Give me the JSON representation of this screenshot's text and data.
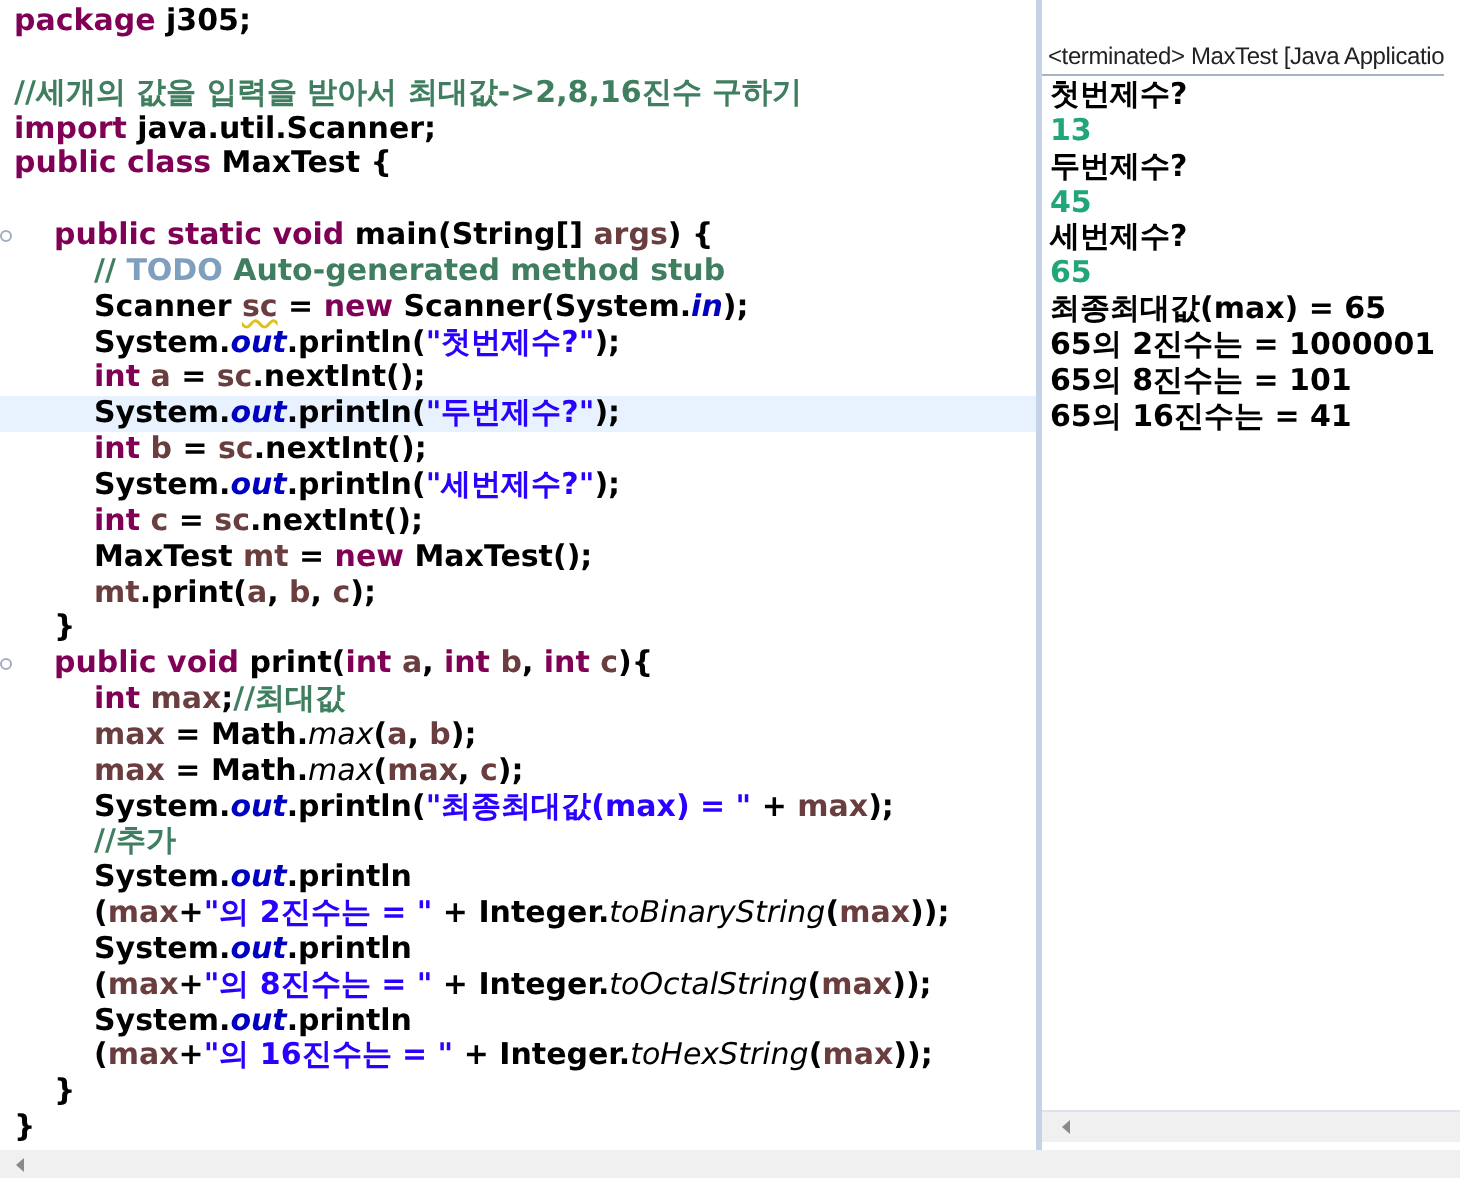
{
  "editor": {
    "lines": [
      {
        "kind": "code",
        "highlighted": false,
        "foldable": false,
        "tokens": [
          {
            "text": "package",
            "kind": "keyword"
          },
          {
            "text": " j305;",
            "kind": "plain"
          }
        ]
      },
      {
        "kind": "blank",
        "highlighted": false,
        "foldable": false
      },
      {
        "kind": "code",
        "highlighted": false,
        "foldable": false,
        "tokens": [
          {
            "text": "//세개의 값을 입력을 받아서 최대값->2,8,16진수 구하기",
            "kind": "comment"
          }
        ]
      },
      {
        "kind": "code",
        "highlighted": false,
        "foldable": false,
        "tokens": [
          {
            "text": "import",
            "kind": "keyword"
          },
          {
            "text": " java.util.Scanner;",
            "kind": "plain"
          }
        ]
      },
      {
        "kind": "code",
        "highlighted": false,
        "foldable": false,
        "tokens": [
          {
            "text": "public class",
            "kind": "keyword"
          },
          {
            "text": " MaxTest {",
            "kind": "plain"
          }
        ]
      },
      {
        "kind": "blank",
        "highlighted": false,
        "foldable": false
      },
      {
        "kind": "code",
        "highlighted": false,
        "foldable": true,
        "tokens": [
          {
            "text": "\tpublic static void",
            "kind": "keyword"
          },
          {
            "text": " main(String[] ",
            "kind": "plain"
          },
          {
            "text": "args",
            "kind": "local"
          },
          {
            "text": ") {",
            "kind": "plain"
          }
        ]
      },
      {
        "kind": "code",
        "highlighted": false,
        "foldable": false,
        "tokens": [
          {
            "text": "\t\t// ",
            "kind": "comment"
          },
          {
            "text": "TODO",
            "kind": "todo"
          },
          {
            "text": " Auto-generated method stub",
            "kind": "comment"
          }
        ]
      },
      {
        "kind": "code",
        "highlighted": false,
        "foldable": false,
        "tokens": [
          {
            "text": "\t\tScanner ",
            "kind": "plain"
          },
          {
            "text": "sc",
            "kind": "warned"
          },
          {
            "text": " = ",
            "kind": "plain"
          },
          {
            "text": "new",
            "kind": "keyword"
          },
          {
            "text": " Scanner(System.",
            "kind": "plain"
          },
          {
            "text": "in",
            "kind": "field"
          },
          {
            "text": ");",
            "kind": "plain"
          }
        ]
      },
      {
        "kind": "code",
        "highlighted": false,
        "foldable": false,
        "tokens": [
          {
            "text": "\t\tSystem.",
            "kind": "plain"
          },
          {
            "text": "out",
            "kind": "field"
          },
          {
            "text": ".println(",
            "kind": "plain"
          },
          {
            "text": "\"첫번제수?\"",
            "kind": "string"
          },
          {
            "text": ");",
            "kind": "plain"
          }
        ]
      },
      {
        "kind": "code",
        "highlighted": false,
        "foldable": false,
        "tokens": [
          {
            "text": "\t\tint ",
            "kind": "keyword"
          },
          {
            "text": "a",
            "kind": "local"
          },
          {
            "text": " = ",
            "kind": "plain"
          },
          {
            "text": "sc",
            "kind": "local"
          },
          {
            "text": ".nextInt();",
            "kind": "plain"
          }
        ]
      },
      {
        "kind": "code",
        "highlighted": true,
        "foldable": false,
        "tokens": [
          {
            "text": "\t\tSystem.",
            "kind": "plain"
          },
          {
            "text": "out",
            "kind": "field"
          },
          {
            "text": ".println(",
            "kind": "plain"
          },
          {
            "text": "\"두번제수?\"",
            "kind": "string"
          },
          {
            "text": ");",
            "kind": "plain"
          }
        ]
      },
      {
        "kind": "code",
        "highlighted": false,
        "foldable": false,
        "tokens": [
          {
            "text": "\t\tint ",
            "kind": "keyword"
          },
          {
            "text": "b",
            "kind": "local"
          },
          {
            "text": " = ",
            "kind": "plain"
          },
          {
            "text": "sc",
            "kind": "local"
          },
          {
            "text": ".nextInt();",
            "kind": "plain"
          }
        ]
      },
      {
        "kind": "code",
        "highlighted": false,
        "foldable": false,
        "tokens": [
          {
            "text": "\t\tSystem.",
            "kind": "plain"
          },
          {
            "text": "out",
            "kind": "field"
          },
          {
            "text": ".println(",
            "kind": "plain"
          },
          {
            "text": "\"세번제수?\"",
            "kind": "string"
          },
          {
            "text": ");",
            "kind": "plain"
          }
        ]
      },
      {
        "kind": "code",
        "highlighted": false,
        "foldable": false,
        "tokens": [
          {
            "text": "\t\tint ",
            "kind": "keyword"
          },
          {
            "text": "c",
            "kind": "local"
          },
          {
            "text": " = ",
            "kind": "plain"
          },
          {
            "text": "sc",
            "kind": "local"
          },
          {
            "text": ".nextInt();",
            "kind": "plain"
          }
        ]
      },
      {
        "kind": "code",
        "highlighted": false,
        "foldable": false,
        "tokens": [
          {
            "text": "\t\tMaxTest ",
            "kind": "plain"
          },
          {
            "text": "mt",
            "kind": "local"
          },
          {
            "text": " = ",
            "kind": "plain"
          },
          {
            "text": "new",
            "kind": "keyword"
          },
          {
            "text": " MaxTest();",
            "kind": "plain"
          }
        ]
      },
      {
        "kind": "code",
        "highlighted": false,
        "foldable": false,
        "tokens": [
          {
            "text": "\t\tmt",
            "kind": "local"
          },
          {
            "text": ".print(",
            "kind": "plain"
          },
          {
            "text": "a",
            "kind": "local"
          },
          {
            "text": ", ",
            "kind": "plain"
          },
          {
            "text": "b",
            "kind": "local"
          },
          {
            "text": ", ",
            "kind": "plain"
          },
          {
            "text": "c",
            "kind": "local"
          },
          {
            "text": ");",
            "kind": "plain"
          }
        ]
      },
      {
        "kind": "code",
        "highlighted": false,
        "foldable": false,
        "tokens": [
          {
            "text": "\t}",
            "kind": "plain"
          }
        ]
      },
      {
        "kind": "code",
        "highlighted": false,
        "foldable": true,
        "tokens": [
          {
            "text": "\tpublic void",
            "kind": "keyword"
          },
          {
            "text": " print(",
            "kind": "plain"
          },
          {
            "text": "int ",
            "kind": "keyword"
          },
          {
            "text": "a",
            "kind": "local"
          },
          {
            "text": ", ",
            "kind": "plain"
          },
          {
            "text": "int ",
            "kind": "keyword"
          },
          {
            "text": "b",
            "kind": "local"
          },
          {
            "text": ", ",
            "kind": "plain"
          },
          {
            "text": "int ",
            "kind": "keyword"
          },
          {
            "text": "c",
            "kind": "local"
          },
          {
            "text": "){",
            "kind": "plain"
          }
        ]
      },
      {
        "kind": "code",
        "highlighted": false,
        "foldable": false,
        "tokens": [
          {
            "text": "\t\tint ",
            "kind": "keyword"
          },
          {
            "text": "max",
            "kind": "local"
          },
          {
            "text": ";",
            "kind": "plain"
          },
          {
            "text": "//최대값",
            "kind": "comment"
          }
        ]
      },
      {
        "kind": "code",
        "highlighted": false,
        "foldable": false,
        "tokens": [
          {
            "text": "\t\tmax",
            "kind": "local"
          },
          {
            "text": " = Math.",
            "kind": "plain"
          },
          {
            "text": "max",
            "kind": "static"
          },
          {
            "text": "(",
            "kind": "plain"
          },
          {
            "text": "a",
            "kind": "local"
          },
          {
            "text": ", ",
            "kind": "plain"
          },
          {
            "text": "b",
            "kind": "local"
          },
          {
            "text": ");",
            "kind": "plain"
          }
        ]
      },
      {
        "kind": "code",
        "highlighted": false,
        "foldable": false,
        "tokens": [
          {
            "text": "\t\tmax",
            "kind": "local"
          },
          {
            "text": " = Math.",
            "kind": "plain"
          },
          {
            "text": "max",
            "kind": "static"
          },
          {
            "text": "(",
            "kind": "plain"
          },
          {
            "text": "max",
            "kind": "local"
          },
          {
            "text": ", ",
            "kind": "plain"
          },
          {
            "text": "c",
            "kind": "local"
          },
          {
            "text": ");",
            "kind": "plain"
          }
        ]
      },
      {
        "kind": "code",
        "highlighted": false,
        "foldable": false,
        "tokens": [
          {
            "text": "\t\tSystem.",
            "kind": "plain"
          },
          {
            "text": "out",
            "kind": "field"
          },
          {
            "text": ".println(",
            "kind": "plain"
          },
          {
            "text": "\"최종최대값(max) = \"",
            "kind": "string"
          },
          {
            "text": " + ",
            "kind": "plain"
          },
          {
            "text": "max",
            "kind": "local"
          },
          {
            "text": ");",
            "kind": "plain"
          }
        ]
      },
      {
        "kind": "code",
        "highlighted": false,
        "foldable": false,
        "tokens": [
          {
            "text": "\t\t//추가",
            "kind": "comment"
          }
        ]
      },
      {
        "kind": "code",
        "highlighted": false,
        "foldable": false,
        "tokens": [
          {
            "text": "\t\tSystem.",
            "kind": "plain"
          },
          {
            "text": "out",
            "kind": "field"
          },
          {
            "text": ".println",
            "kind": "plain"
          }
        ]
      },
      {
        "kind": "code",
        "highlighted": false,
        "foldable": false,
        "tokens": [
          {
            "text": "\t\t(",
            "kind": "plain"
          },
          {
            "text": "max",
            "kind": "local"
          },
          {
            "text": "+",
            "kind": "plain"
          },
          {
            "text": "\"의 2진수는 = \"",
            "kind": "string"
          },
          {
            "text": " + Integer.",
            "kind": "plain"
          },
          {
            "text": "toBinaryString",
            "kind": "static"
          },
          {
            "text": "(",
            "kind": "plain"
          },
          {
            "text": "max",
            "kind": "local"
          },
          {
            "text": "));",
            "kind": "plain"
          }
        ]
      },
      {
        "kind": "code",
        "highlighted": false,
        "foldable": false,
        "tokens": [
          {
            "text": "\t\tSystem.",
            "kind": "plain"
          },
          {
            "text": "out",
            "kind": "field"
          },
          {
            "text": ".println",
            "kind": "plain"
          }
        ]
      },
      {
        "kind": "code",
        "highlighted": false,
        "foldable": false,
        "tokens": [
          {
            "text": "\t\t(",
            "kind": "plain"
          },
          {
            "text": "max",
            "kind": "local"
          },
          {
            "text": "+",
            "kind": "plain"
          },
          {
            "text": "\"의 8진수는 = \"",
            "kind": "string"
          },
          {
            "text": " + Integer.",
            "kind": "plain"
          },
          {
            "text": "toOctalString",
            "kind": "static"
          },
          {
            "text": "(",
            "kind": "plain"
          },
          {
            "text": "max",
            "kind": "local"
          },
          {
            "text": "));",
            "kind": "plain"
          }
        ]
      },
      {
        "kind": "code",
        "highlighted": false,
        "foldable": false,
        "tokens": [
          {
            "text": "\t\tSystem.",
            "kind": "plain"
          },
          {
            "text": "out",
            "kind": "field"
          },
          {
            "text": ".println",
            "kind": "plain"
          }
        ]
      },
      {
        "kind": "code",
        "highlighted": false,
        "foldable": false,
        "tokens": [
          {
            "text": "\t\t(",
            "kind": "plain"
          },
          {
            "text": "max",
            "kind": "local"
          },
          {
            "text": "+",
            "kind": "plain"
          },
          {
            "text": "\"의 16진수는 = \"",
            "kind": "string"
          },
          {
            "text": " + Integer.",
            "kind": "plain"
          },
          {
            "text": "toHexString",
            "kind": "static"
          },
          {
            "text": "(",
            "kind": "plain"
          },
          {
            "text": "max",
            "kind": "local"
          },
          {
            "text": "));",
            "kind": "plain"
          }
        ]
      },
      {
        "kind": "code",
        "highlighted": false,
        "foldable": false,
        "tokens": [
          {
            "text": "\t}",
            "kind": "plain"
          }
        ]
      },
      {
        "kind": "code",
        "highlighted": false,
        "foldable": false,
        "tokens": [
          {
            "text": "}",
            "kind": "plain"
          }
        ]
      }
    ]
  },
  "console": {
    "header": "<terminated> MaxTest [Java Applicatio",
    "lines": [
      {
        "kind": "output",
        "text": "첫번제수?"
      },
      {
        "kind": "input",
        "text": "13"
      },
      {
        "kind": "output",
        "text": "두번제수?"
      },
      {
        "kind": "input",
        "text": "45"
      },
      {
        "kind": "output",
        "text": "세번제수?"
      },
      {
        "kind": "input",
        "text": "65"
      },
      {
        "kind": "output",
        "text": "최종최대값(max) = 65"
      },
      {
        "kind": "output",
        "text": "65의 2진수는 = 1000001"
      },
      {
        "kind": "output",
        "text": "65의 8진수는 = 101"
      },
      {
        "kind": "output",
        "text": "65의 16진수는 = 41"
      }
    ]
  }
}
